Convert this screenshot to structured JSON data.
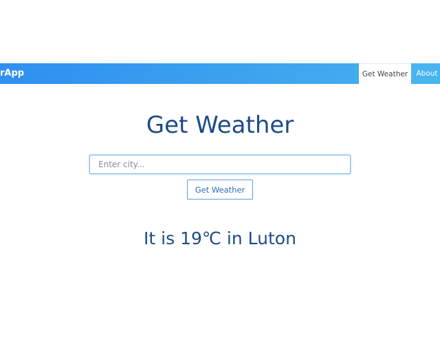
{
  "navbar": {
    "brand": "rApp",
    "tabs": [
      {
        "label": "Get Weather",
        "active": true
      },
      {
        "label": "About",
        "active": false
      }
    ]
  },
  "main": {
    "title": "Get Weather",
    "city_input": {
      "value": "",
      "placeholder": "Enter city..."
    },
    "submit_label": "Get Weather",
    "result": "It is 19℃ in Luton"
  },
  "colors": {
    "navbar_start": "#2f8ff0",
    "navbar_end": "#47b2ee",
    "heading_text": "#1d4b85",
    "button_border": "#5a9be0"
  }
}
